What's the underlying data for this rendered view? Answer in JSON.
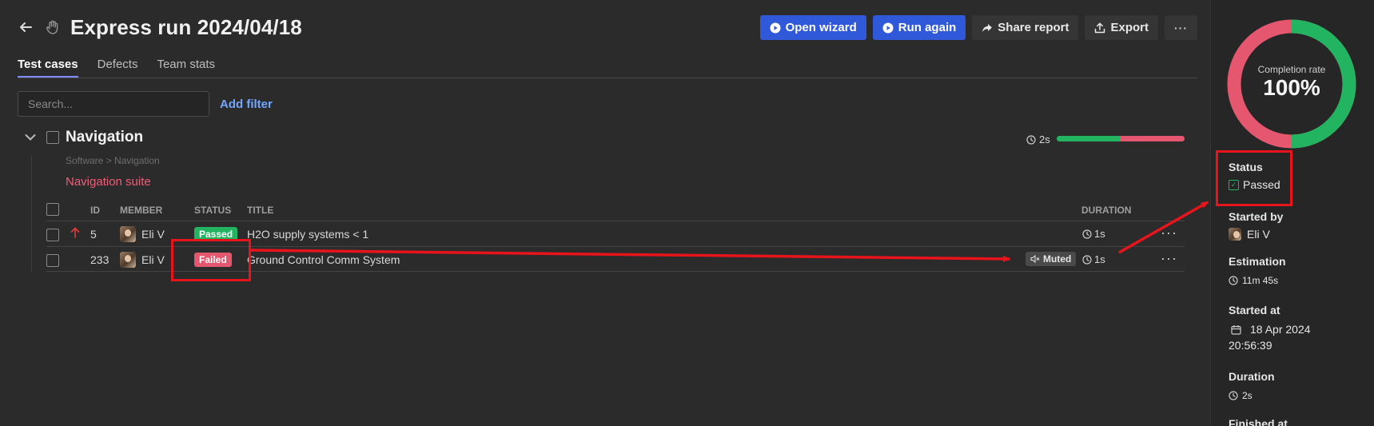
{
  "header": {
    "title": "Express run 2024/04/18"
  },
  "actions": {
    "open_wizard": "Open wizard",
    "run_again": "Run again",
    "share_report": "Share report",
    "export": "Export",
    "more": "···"
  },
  "tabs": [
    {
      "label": "Test cases",
      "active": true
    },
    {
      "label": "Defects",
      "active": false
    },
    {
      "label": "Team stats",
      "active": false
    }
  ],
  "filters": {
    "search_placeholder": "Search...",
    "add_filter": "Add filter"
  },
  "suite": {
    "name": "Navigation",
    "duration": "2s",
    "progress": {
      "passed_fraction": 0.5,
      "failed_fraction": 0.5
    },
    "breadcrumb": "Software > Navigation",
    "link": "Navigation suite"
  },
  "table": {
    "headers": {
      "id": "ID",
      "member": "MEMBER",
      "status": "STATUS",
      "title": "TITLE",
      "duration": "DURATION"
    },
    "rows": [
      {
        "id": "5",
        "member": "Eli V",
        "status": "Passed",
        "title": "H2O supply systems < 1",
        "duration": "1s",
        "priority_icon": "arrow-up-icon",
        "muted": ""
      },
      {
        "id": "233",
        "member": "Eli V",
        "status": "Failed",
        "title": "Ground Control Comm System",
        "duration": "1s",
        "priority_icon": "",
        "muted": "Muted"
      }
    ]
  },
  "sidebar": {
    "completion": {
      "label": "Completion rate",
      "value": "100%",
      "passed_fraction": 0.5,
      "failed_fraction": 0.5
    },
    "status": {
      "label": "Status",
      "value": "Passed"
    },
    "started_by": {
      "label": "Started by",
      "value": "Eli V"
    },
    "estimation": {
      "label": "Estimation",
      "value": "11m 45s"
    },
    "started_at": {
      "label": "Started at",
      "date": "18 Apr 2024",
      "time": "20:56:39"
    },
    "duration": {
      "label": "Duration",
      "value": "2s"
    },
    "finished_at": {
      "label": "Finished at"
    }
  },
  "colors": {
    "passed": "#22b461",
    "failed": "#e5576f",
    "accent": "#2f59d8",
    "annotation": "#e8141b"
  }
}
